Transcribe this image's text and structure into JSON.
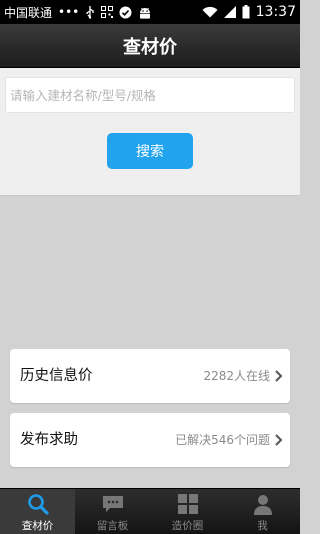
{
  "status_bar": {
    "carrier": "中国联通",
    "dots": "•••",
    "time": "13:37"
  },
  "header": {
    "title": "查材价"
  },
  "search": {
    "placeholder": "请输入建材名称/型号/规格",
    "value": "",
    "button_label": "搜索"
  },
  "list": [
    {
      "label": "历史信息价",
      "meta": "2282人在线"
    },
    {
      "label": "发布求助",
      "meta": "已解决546个问题"
    }
  ],
  "tabs": [
    {
      "label": "查材价",
      "icon": "search-icon",
      "active": true
    },
    {
      "label": "留言板",
      "icon": "message-icon",
      "active": false
    },
    {
      "label": "造价圈",
      "icon": "grid-icon",
      "active": false
    },
    {
      "label": "我",
      "icon": "user-icon",
      "active": false
    }
  ],
  "colors": {
    "accent": "#22a3ee",
    "active_tab_icon": "#1e9be8"
  }
}
